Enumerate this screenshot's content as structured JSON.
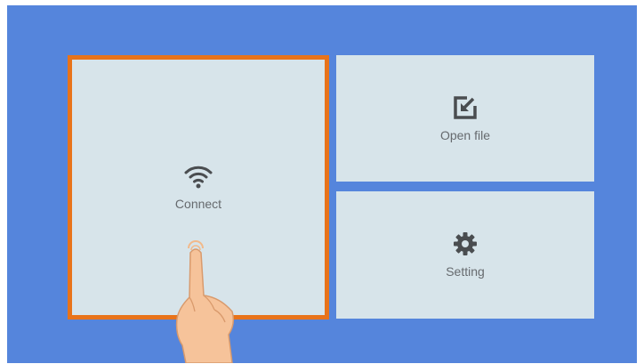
{
  "tiles": {
    "connect": {
      "label": "Connect",
      "icon": "wifi-icon"
    },
    "open_file": {
      "label": "Open file",
      "icon": "open-file-icon"
    },
    "setting": {
      "label": "Setting",
      "icon": "gear-icon"
    }
  },
  "colors": {
    "background": "#5585dc",
    "tile": "#d7e4ea",
    "selection_border": "#e8731a",
    "icon": "#4a4d50"
  },
  "selected_tile": "connect"
}
